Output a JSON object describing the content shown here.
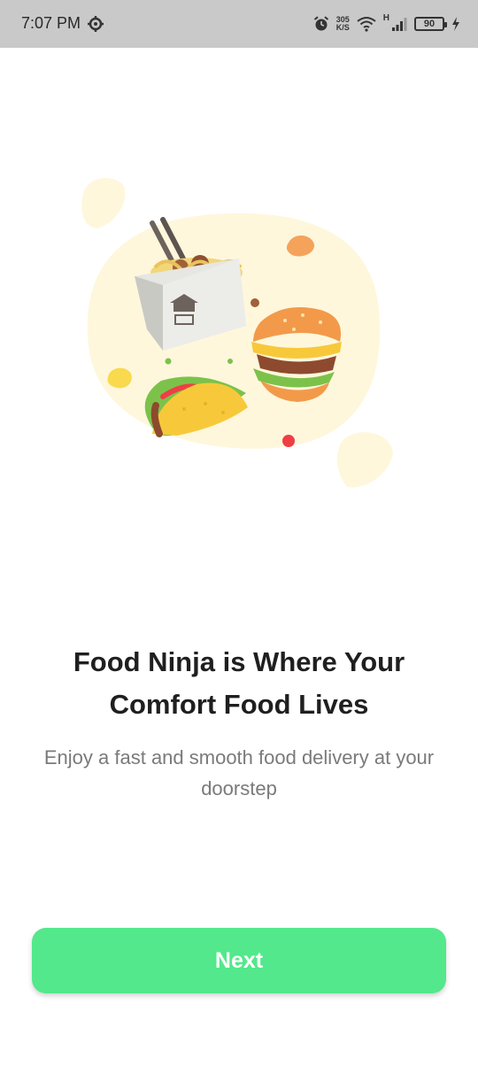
{
  "status_bar": {
    "time": "7:07 PM",
    "net_speed_value": "305",
    "net_speed_unit": "K/S",
    "network_type": "H",
    "battery_level": "90"
  },
  "onboarding": {
    "headline": "Food Ninja is Where Your Comfort Food Lives",
    "subtitle": "Enjoy a fast and smooth food delivery at your doorstep",
    "next_label": "Next"
  },
  "icons": [
    "gear-icon",
    "alarm-icon",
    "wifi-icon",
    "signal-icon",
    "battery-icon",
    "charging-icon"
  ],
  "colors": {
    "accent": "#53e88b",
    "blob": "#fef7dc",
    "headline": "#1f1f1f",
    "subtitle": "#7a7a7a",
    "status_bar_bg": "#c9c9c9"
  }
}
